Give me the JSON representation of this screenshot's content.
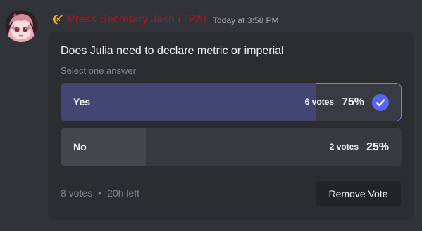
{
  "message": {
    "avatar_icon": "user-avatar",
    "role_icon": "crescent-moon-icon",
    "username": "Press Secretary Jash (TPA)",
    "username_color": "#b8101a",
    "timestamp": "Today at 3:58 PM"
  },
  "poll": {
    "question": "Does Julia need to declare metric or imperial",
    "hint": "Select one answer",
    "answers": [
      {
        "label": "Yes",
        "votes_text": "6 votes",
        "percent_text": "75%",
        "fraction": 0.75,
        "selected": true,
        "check_icon": "check-icon"
      },
      {
        "label": "No",
        "votes_text": "2 votes",
        "percent_text": "25%",
        "fraction": 0.25,
        "selected": false
      }
    ],
    "total_votes": "8 votes",
    "separator": "•",
    "time_left": "20h left",
    "remove_vote_label": "Remove Vote",
    "accent_color": "#5865f2"
  }
}
